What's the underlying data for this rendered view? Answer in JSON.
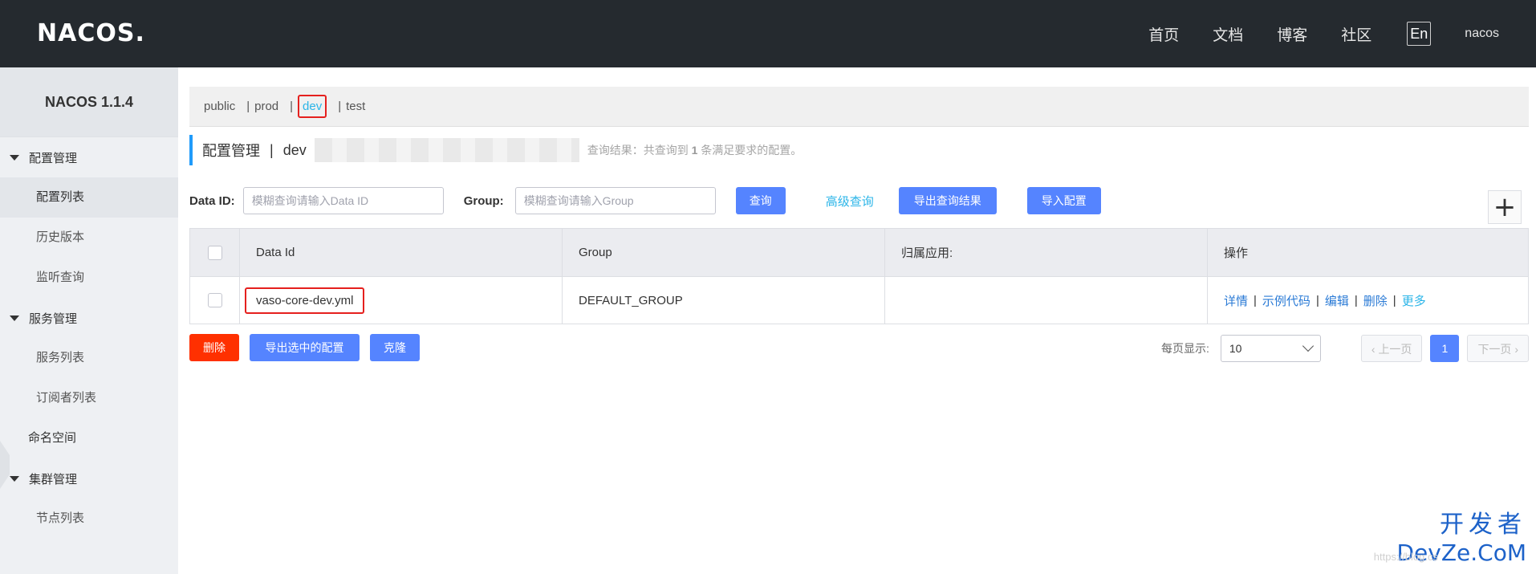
{
  "header": {
    "logo": "NACOS.",
    "nav": [
      "首页",
      "文档",
      "博客",
      "社区"
    ],
    "lang": "En",
    "user": "nacos"
  },
  "sidebar": {
    "version": "NACOS 1.1.4",
    "groups": [
      {
        "label": "配置管理",
        "items": [
          "配置列表",
          "历史版本",
          "监听查询"
        ]
      },
      {
        "label": "服务管理",
        "items": [
          "服务列表",
          "订阅者列表"
        ]
      },
      {
        "label": "命名空间"
      },
      {
        "label": "集群管理",
        "items": [
          "节点列表"
        ]
      }
    ]
  },
  "namespaces": [
    "public",
    "prod",
    "dev",
    "test"
  ],
  "title": {
    "section": "配置管理",
    "sep": "|",
    "ns": "dev",
    "result_prefix": "查询结果：共查询到",
    "result_count": "1",
    "result_suffix": "条满足要求的配置。"
  },
  "search": {
    "dataid_label": "Data ID:",
    "dataid_placeholder": "模糊查询请输入Data ID",
    "group_label": "Group:",
    "group_placeholder": "模糊查询请输入Group",
    "query_btn": "查询",
    "advanced": "高级查询",
    "export_btn": "导出查询结果",
    "import_btn": "导入配置",
    "add_icon": "+"
  },
  "table": {
    "headers": [
      "Data Id",
      "Group",
      "归属应用:",
      "操作"
    ],
    "rows": [
      {
        "data_id": "vaso-core-dev.yml",
        "group": "DEFAULT_GROUP",
        "app": ""
      }
    ],
    "ops": [
      "详情",
      "示例代码",
      "编辑",
      "删除",
      "更多"
    ]
  },
  "bottom": {
    "delete_btn": "删除",
    "export_selected_btn": "导出选中的配置",
    "clone_btn": "克隆",
    "page_size_label": "每页显示:",
    "page_size": "10",
    "prev": "上一页",
    "current_page": "1",
    "next": "下一页"
  },
  "watermark": {
    "line1": "开发者",
    "line2": "DevZe.CoM",
    "url": "https://blog.cs"
  },
  "colors": {
    "primary": "#5584ff",
    "danger": "#ff3000",
    "accent": "#209bfa",
    "link": "#2bb5e8",
    "highlight": "#e5201e"
  }
}
